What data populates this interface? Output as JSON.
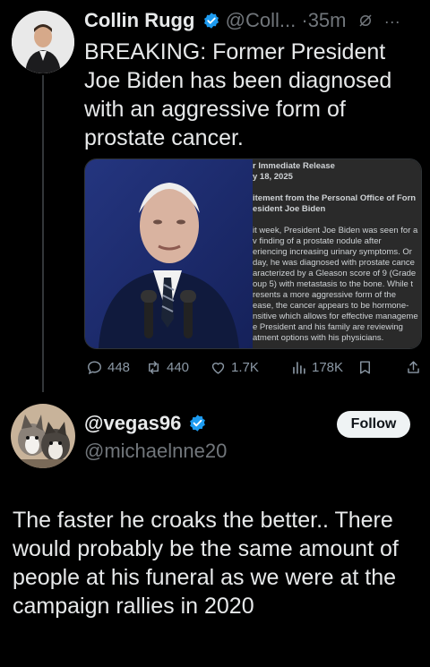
{
  "tweet": {
    "author_name": "Collin Rugg",
    "author_handle": "@Coll...",
    "time": "·35m",
    "text": "BREAKING: Former President Joe Biden has been diagnosed with an aggressive form of prostate cancer.",
    "doc": {
      "lines": [
        "r Immediate Release",
        "y 18, 2025",
        "",
        "itement from the Personal Office of Forn",
        "esident Joe Biden",
        "",
        "it week, President Joe Biden was seen for a",
        "v finding of a prostate nodule after",
        "eriencing increasing urinary symptoms. Or",
        "day, he was diagnosed with prostate cance",
        "aracterized by a Gleason score of 9 (Grade",
        "oup 5) with metastasis to the bone. While t",
        "resents a more aggressive form of the",
        "ease, the cancer appears to be hormone-",
        "nsitive which allows for effective manageme",
        "e President and his family are reviewing",
        "atment options with his physicians."
      ]
    },
    "stats": {
      "replies": "448",
      "reposts": "440",
      "likes": "1.7K",
      "views": "178K"
    }
  },
  "reply": {
    "author_name": "@vegas96",
    "author_handle": "@michaelnne20",
    "follow_label": "Follow",
    "text": "The faster he croaks the  better.. There would  probably be the same amount of people at his funeral as we were at the campaign rallies in 2020"
  },
  "colors": {
    "verified": "#1d9bf0",
    "background": "#000000",
    "muted": "#71767b"
  }
}
